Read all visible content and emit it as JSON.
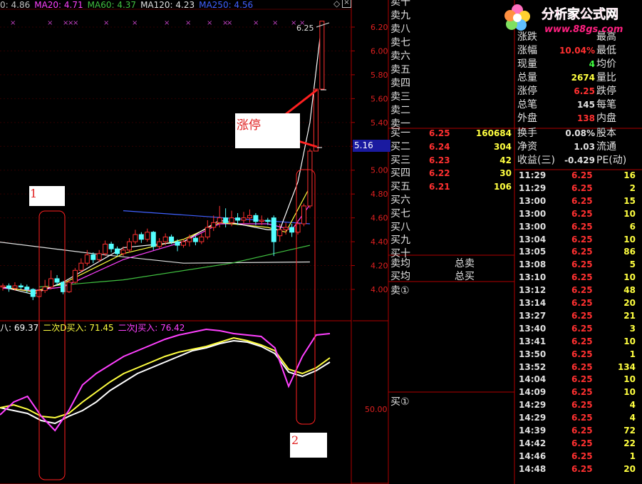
{
  "ma_bar": {
    "items": [
      {
        "label": "0: 4.86",
        "color": "#c0c0c0"
      },
      {
        "label": "MA20: 4.71",
        "color": "#ff40ff"
      },
      {
        "label": "MA60: 4.37",
        "color": "#40c040"
      },
      {
        "label": "MA120: 4.23",
        "color": "#e0e0e0"
      },
      {
        "label": "MA250: 4.56",
        "color": "#4060ff"
      }
    ]
  },
  "indicator_bar": {
    "items": [
      {
        "label": "八: 69.37",
        "color": "#ffffff"
      },
      {
        "label": "二次D买入: 71.45",
        "color": "#ffff40"
      },
      {
        "label": "二次J买入: 76.42",
        "color": "#ff40ff"
      }
    ]
  },
  "chart_data": {
    "type": "candlestick",
    "y_axis_ticks": [
      "6.20",
      "6.00",
      "5.80",
      "5.60",
      "5.40",
      "5.20",
      "5.00",
      "4.80",
      "4.60",
      "4.40",
      "4.20",
      "4.00"
    ],
    "ylim": [
      3.95,
      6.25
    ],
    "high_label": "6.25",
    "cursor_price": "5.16",
    "indicator_tick": "50.00",
    "candles": [
      {
        "o": 4.02,
        "c": 4.03,
        "h": 4.05,
        "l": 3.99
      },
      {
        "o": 4.03,
        "c": 4.01,
        "h": 4.05,
        "l": 3.98
      },
      {
        "o": 4.01,
        "c": 4.03,
        "h": 4.06,
        "l": 3.99
      },
      {
        "o": 4.03,
        "c": 4.02,
        "h": 4.05,
        "l": 4.0
      },
      {
        "o": 4.02,
        "c": 4.0,
        "h": 4.04,
        "l": 3.97
      },
      {
        "o": 4.0,
        "c": 3.94,
        "h": 4.01,
        "l": 3.91
      },
      {
        "o": 3.94,
        "c": 3.99,
        "h": 4.0,
        "l": 3.93
      },
      {
        "o": 3.99,
        "c": 4.02,
        "h": 4.08,
        "l": 3.97
      },
      {
        "o": 4.02,
        "c": 4.09,
        "h": 4.16,
        "l": 4.0
      },
      {
        "o": 4.09,
        "c": 4.06,
        "h": 4.12,
        "l": 4.03
      },
      {
        "o": 4.06,
        "c": 3.98,
        "h": 4.07,
        "l": 3.96
      },
      {
        "o": 3.98,
        "c": 4.06,
        "h": 4.08,
        "l": 3.97
      },
      {
        "o": 4.06,
        "c": 4.16,
        "h": 4.18,
        "l": 4.05
      },
      {
        "o": 4.16,
        "c": 4.22,
        "h": 4.26,
        "l": 4.14
      },
      {
        "o": 4.22,
        "c": 4.29,
        "h": 4.33,
        "l": 4.2
      },
      {
        "o": 4.29,
        "c": 4.25,
        "h": 4.31,
        "l": 4.22
      },
      {
        "o": 4.25,
        "c": 4.3,
        "h": 4.33,
        "l": 4.23
      },
      {
        "o": 4.3,
        "c": 4.38,
        "h": 4.41,
        "l": 4.28
      },
      {
        "o": 4.38,
        "c": 4.34,
        "h": 4.4,
        "l": 4.31
      },
      {
        "o": 4.34,
        "c": 4.3,
        "h": 4.36,
        "l": 4.28
      },
      {
        "o": 4.3,
        "c": 4.33,
        "h": 4.36,
        "l": 4.28
      },
      {
        "o": 4.33,
        "c": 4.4,
        "h": 4.43,
        "l": 4.31
      },
      {
        "o": 4.4,
        "c": 4.46,
        "h": 4.5,
        "l": 4.38
      },
      {
        "o": 4.46,
        "c": 4.42,
        "h": 4.48,
        "l": 4.39
      },
      {
        "o": 4.42,
        "c": 4.48,
        "h": 4.51,
        "l": 4.4
      },
      {
        "o": 4.48,
        "c": 4.36,
        "h": 4.49,
        "l": 4.33
      },
      {
        "o": 4.36,
        "c": 4.4,
        "h": 4.43,
        "l": 4.34
      },
      {
        "o": 4.4,
        "c": 4.44,
        "h": 4.47,
        "l": 4.37
      },
      {
        "o": 4.44,
        "c": 4.4,
        "h": 4.46,
        "l": 4.38
      },
      {
        "o": 4.4,
        "c": 4.37,
        "h": 4.42,
        "l": 4.32
      },
      {
        "o": 4.37,
        "c": 4.4,
        "h": 4.42,
        "l": 4.35
      },
      {
        "o": 4.4,
        "c": 4.43,
        "h": 4.46,
        "l": 4.36
      },
      {
        "o": 4.43,
        "c": 4.4,
        "h": 4.45,
        "l": 4.37
      },
      {
        "o": 4.4,
        "c": 4.44,
        "h": 4.47,
        "l": 4.38
      },
      {
        "o": 4.44,
        "c": 4.52,
        "h": 4.58,
        "l": 4.42
      },
      {
        "o": 4.52,
        "c": 4.56,
        "h": 4.62,
        "l": 4.49
      },
      {
        "o": 4.56,
        "c": 4.6,
        "h": 4.7,
        "l": 4.52
      },
      {
        "o": 4.6,
        "c": 4.56,
        "h": 4.68,
        "l": 4.52
      },
      {
        "o": 4.56,
        "c": 4.6,
        "h": 4.66,
        "l": 4.53
      },
      {
        "o": 4.6,
        "c": 4.58,
        "h": 4.64,
        "l": 4.54
      },
      {
        "o": 4.58,
        "c": 4.6,
        "h": 4.65,
        "l": 4.55
      },
      {
        "o": 4.6,
        "c": 4.62,
        "h": 4.67,
        "l": 4.56
      },
      {
        "o": 4.62,
        "c": 4.57,
        "h": 4.64,
        "l": 4.54
      },
      {
        "o": 4.57,
        "c": 4.58,
        "h": 4.62,
        "l": 4.54
      },
      {
        "o": 4.58,
        "c": 4.57,
        "h": 4.6,
        "l": 4.54
      },
      {
        "o": 4.6,
        "c": 4.4,
        "h": 4.62,
        "l": 4.28
      },
      {
        "o": 4.45,
        "c": 4.5,
        "h": 4.55,
        "l": 4.4
      },
      {
        "o": 4.5,
        "c": 4.52,
        "h": 4.56,
        "l": 4.46
      },
      {
        "o": 4.52,
        "c": 4.48,
        "h": 4.55,
        "l": 4.44
      },
      {
        "o": 4.48,
        "c": 4.55,
        "h": 4.58,
        "l": 4.46
      },
      {
        "o": 4.55,
        "c": 4.7,
        "h": 4.72,
        "l": 4.53
      },
      {
        "o": 4.7,
        "c": 5.16,
        "h": 5.18,
        "l": 4.68
      },
      {
        "o": 5.16,
        "c": 5.68,
        "h": 5.68,
        "l": 5.16
      },
      {
        "o": 5.68,
        "c": 6.25,
        "h": 6.25,
        "l": 5.68
      }
    ],
    "ma_series": [
      {
        "name": "MA250",
        "color": "#4060ff",
        "x": [
          20,
          51
        ],
        "y": [
          4.66,
          4.55
        ]
      },
      {
        "name": "MA120",
        "color": "#e0e0e0",
        "x": [
          -1,
          15,
          30,
          51
        ],
        "y": [
          4.4,
          4.3,
          4.22,
          4.23
        ]
      },
      {
        "name": "MA60",
        "color": "#40c040",
        "x": [
          6,
          20,
          38,
          51
        ],
        "y": [
          4.02,
          4.08,
          4.22,
          4.37
        ]
      },
      {
        "name": "MA20",
        "color": "#ff40ff",
        "x": [
          0,
          5,
          10,
          20,
          30,
          36,
          44,
          48,
          51
        ],
        "y": [
          4.01,
          3.99,
          4.02,
          4.25,
          4.4,
          4.55,
          4.55,
          4.5,
          4.71
        ]
      },
      {
        "name": "MA10",
        "color": "#ffff40",
        "x": [
          0,
          5,
          10,
          20,
          30,
          36,
          44,
          47,
          51
        ],
        "y": [
          4.02,
          3.98,
          4.05,
          4.3,
          4.42,
          4.56,
          4.52,
          4.48,
          4.86
        ]
      },
      {
        "name": "MA5",
        "color": "#ffffff",
        "x": [
          0,
          5,
          10,
          20,
          30,
          36,
          44,
          46,
          49,
          51,
          53
        ],
        "y": [
          4.02,
          3.96,
          4.06,
          4.35,
          4.4,
          4.58,
          4.5,
          4.5,
          4.9,
          5.4,
          6.25
        ]
      }
    ],
    "indicator_series": [
      {
        "name": "八",
        "color": "#ffffff",
        "values": [
          0.44,
          0.42,
          0.4,
          0.35,
          0.33,
          0.38,
          0.42,
          0.48,
          0.56,
          0.62,
          0.68,
          0.72,
          0.76,
          0.8,
          0.84,
          0.86,
          0.89,
          0.91,
          0.9,
          0.87,
          0.82,
          0.69,
          0.66,
          0.7,
          0.76
        ]
      },
      {
        "name": "二次D买入",
        "color": "#ffff40",
        "values": [
          0.44,
          0.46,
          0.43,
          0.38,
          0.37,
          0.4,
          0.48,
          0.55,
          0.62,
          0.68,
          0.72,
          0.76,
          0.8,
          0.83,
          0.85,
          0.87,
          0.9,
          0.93,
          0.91,
          0.88,
          0.84,
          0.71,
          0.68,
          0.72,
          0.79
        ]
      },
      {
        "name": "二次J买入",
        "color": "#ff40ff",
        "values": [
          0.39,
          0.48,
          0.52,
          0.38,
          0.28,
          0.42,
          0.6,
          0.68,
          0.74,
          0.8,
          0.84,
          0.88,
          0.92,
          0.95,
          0.97,
          0.99,
          0.98,
          0.96,
          0.95,
          0.94,
          0.86,
          0.59,
          0.8,
          0.95,
          0.96
        ]
      }
    ],
    "markers": [
      "×",
      "×",
      "×",
      "×",
      "×",
      "×",
      "×",
      "×",
      "×",
      "×",
      "×",
      "×",
      "×",
      "×",
      "×",
      "×"
    ]
  },
  "annotations": {
    "limit_up": "涨停",
    "box1": "1",
    "box2": "2"
  },
  "order_book": {
    "sell_upper": [
      "卖十",
      "卖九",
      "卖八",
      "卖七",
      "卖六",
      "卖五",
      "卖四",
      "卖三",
      "卖二",
      "卖一"
    ],
    "buys": [
      {
        "label": "买一",
        "price": "6.25",
        "vol": "160684"
      },
      {
        "label": "买二",
        "price": "6.24",
        "vol": "304"
      },
      {
        "label": "买三",
        "price": "6.23",
        "vol": "42"
      },
      {
        "label": "买四",
        "price": "6.22",
        "vol": "30"
      },
      {
        "label": "买五",
        "price": "6.21",
        "vol": "106"
      },
      {
        "label": "买六",
        "price": "",
        "vol": ""
      },
      {
        "label": "买七",
        "price": "",
        "vol": ""
      },
      {
        "label": "买八",
        "price": "",
        "vol": ""
      },
      {
        "label": "买九",
        "price": "",
        "vol": ""
      },
      {
        "label": "买十",
        "price": "",
        "vol": ""
      }
    ],
    "sell_avg": "卖均",
    "buy_avg": "买均",
    "total_sell": "总卖",
    "total_buy": "总买",
    "sell_marker": "卖①",
    "buy_marker": "买①"
  },
  "stats": [
    {
      "k1": "涨跌",
      "v1": "",
      "c1": "#ff3030",
      "k2": "最高"
    },
    {
      "k1": "涨幅",
      "v1": "10.04%",
      "c1": "#ff3030",
      "k2": "最低"
    },
    {
      "k1": "现量",
      "v1": "4",
      "c1": "#40ff40",
      "k2": "均价"
    },
    {
      "k1": "总量",
      "v1": "2674",
      "c1": "#ffff40",
      "k2": "量比"
    },
    {
      "k1": "涨停",
      "v1": "6.25",
      "c1": "#ff3030",
      "k2": "跌停"
    },
    {
      "k1": "总笔",
      "v1": "145",
      "c1": "#e0e0e0",
      "k2": "每笔"
    },
    {
      "k1": "外盘",
      "v1": "138",
      "c1": "#ff3030",
      "k2": "内盘"
    },
    {
      "k1": "换手",
      "v1": "0.08%",
      "c1": "#e0e0e0",
      "k2": "股本"
    },
    {
      "k1": "净资",
      "v1": "1.03",
      "c1": "#e0e0e0",
      "k2": "流通"
    },
    {
      "k1": "收益(三)",
      "v1": "-0.429",
      "c1": "#e0e0e0",
      "k2": "PE(动)"
    }
  ],
  "ticks": [
    {
      "t": "11:29",
      "p": "6.25",
      "v": "16"
    },
    {
      "t": "11:29",
      "p": "6.25",
      "v": "2"
    },
    {
      "t": "13:00",
      "p": "6.25",
      "v": "15"
    },
    {
      "t": "13:00",
      "p": "6.25",
      "v": "10"
    },
    {
      "t": "13:00",
      "p": "6.25",
      "v": "6"
    },
    {
      "t": "13:04",
      "p": "6.25",
      "v": "10"
    },
    {
      "t": "13:05",
      "p": "6.25",
      "v": "86"
    },
    {
      "t": "13:08",
      "p": "6.25",
      "v": "5"
    },
    {
      "t": "13:10",
      "p": "6.25",
      "v": "10"
    },
    {
      "t": "13:12",
      "p": "6.25",
      "v": "48"
    },
    {
      "t": "13:14",
      "p": "6.25",
      "v": "20"
    },
    {
      "t": "13:27",
      "p": "6.25",
      "v": "21"
    },
    {
      "t": "13:40",
      "p": "6.25",
      "v": "3"
    },
    {
      "t": "13:41",
      "p": "6.25",
      "v": "10"
    },
    {
      "t": "13:50",
      "p": "6.25",
      "v": "1"
    },
    {
      "t": "13:52",
      "p": "6.25",
      "v": "134"
    },
    {
      "t": "14:04",
      "p": "6.25",
      "v": "10"
    },
    {
      "t": "14:09",
      "p": "6.25",
      "v": "10"
    },
    {
      "t": "14:29",
      "p": "6.25",
      "v": "4"
    },
    {
      "t": "14:29",
      "p": "6.25",
      "v": "4"
    },
    {
      "t": "14:39",
      "p": "6.25",
      "v": "72"
    },
    {
      "t": "14:42",
      "p": "6.25",
      "v": "22"
    },
    {
      "t": "14:46",
      "p": "6.25",
      "v": "1"
    },
    {
      "t": "14:48",
      "p": "6.25",
      "v": "20"
    }
  ],
  "watermark": {
    "line1": "分析家公式网",
    "line2": "www.88gs.com"
  }
}
